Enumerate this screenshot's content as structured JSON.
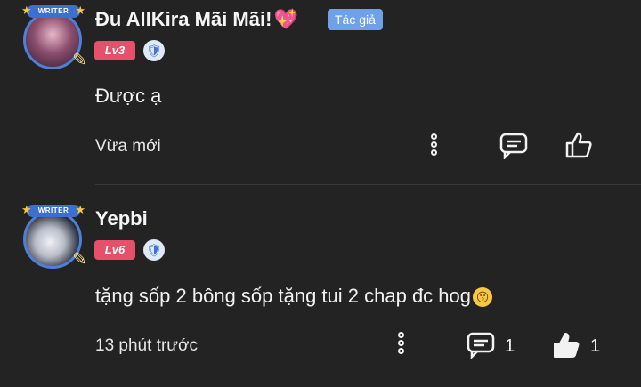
{
  "comments": [
    {
      "username": "Đu AllKira Mãi Mãi!",
      "author_tag": "Tác giả",
      "level": "Lv3",
      "writer_badge": "WRITER",
      "content": "Được ạ",
      "time": "Vừa mới",
      "reply_count": "",
      "like_count": ""
    },
    {
      "username": "Yepbi",
      "level": "Lv6",
      "writer_badge": "WRITER",
      "content": "tặng sốp 2 bông sốp tặng tui 2 chap đc hog",
      "time": "13 phút trước",
      "reply_count": "1",
      "like_count": "1"
    }
  ],
  "colors": {
    "background": "#232323",
    "level_badge": "#e5506b",
    "author_tag": "#6fa0e8",
    "avatar_ring": "#4f7fd6"
  },
  "icons": [
    "writer-avatar-frame",
    "shield-icon",
    "more-icon",
    "reply-icon",
    "like-icon",
    "sparkling-heart-emoji",
    "hushed-face-emoji"
  ]
}
